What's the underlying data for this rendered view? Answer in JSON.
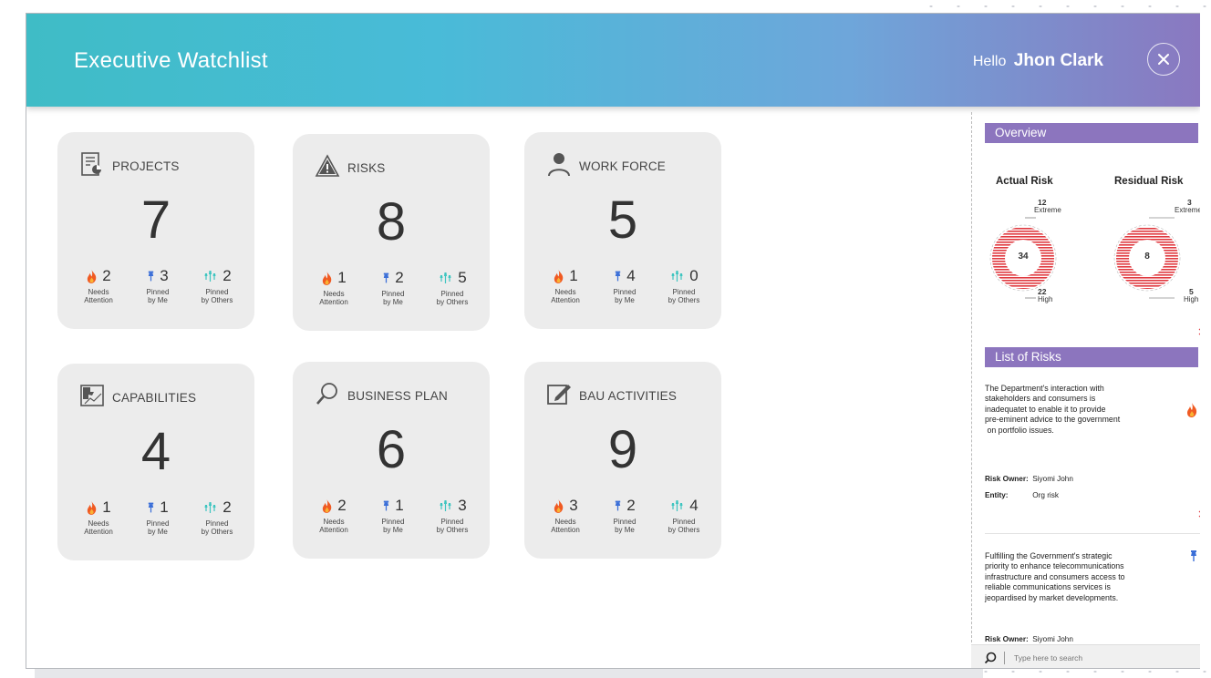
{
  "header": {
    "title": "Executive Watchlist",
    "greeting": "Hello",
    "user_name": "Jhon Clark"
  },
  "cards": [
    {
      "title": "PROJECTS",
      "icon": "document-chart-icon",
      "count": "7",
      "needs_attention": "2",
      "pinned_by_me": "3",
      "pinned_by_others": "2"
    },
    {
      "title": "RISKS",
      "icon": "warning-triangle-icon",
      "count": "8",
      "needs_attention": "1",
      "pinned_by_me": "2",
      "pinned_by_others": "5"
    },
    {
      "title": "WORK FORCE",
      "icon": "person-icon",
      "count": "5",
      "needs_attention": "1",
      "pinned_by_me": "4",
      "pinned_by_others": "0"
    },
    {
      "title": "CAPABILITIES",
      "icon": "puzzle-image-icon",
      "count": "4",
      "needs_attention": "1",
      "pinned_by_me": "1",
      "pinned_by_others": "2"
    },
    {
      "title": "BUSINESS PLAN",
      "icon": "magnifier-icon",
      "count": "6",
      "needs_attention": "2",
      "pinned_by_me": "1",
      "pinned_by_others": "3"
    },
    {
      "title": "BAU ACTIVITIES",
      "icon": "edit-pencil-icon",
      "count": "9",
      "needs_attention": "3",
      "pinned_by_me": "2",
      "pinned_by_others": "4"
    }
  ],
  "stat_labels": {
    "needs_attention": [
      "Needs",
      "Attention"
    ],
    "pinned_by_me": [
      "Pinned",
      "by Me"
    ],
    "pinned_by_others": [
      "Pinned",
      "by Others"
    ]
  },
  "overview": {
    "title": "Overview",
    "actual": {
      "label": "Actual Risk",
      "total": "34",
      "extreme_count": "12",
      "extreme_label": "Extreme",
      "high_count": "22",
      "high_label": "High"
    },
    "residual": {
      "label": "Residual Risk",
      "total": "8",
      "extreme_count": "3",
      "extreme_label": "Extreme",
      "high_count": "5",
      "high_label": "High"
    }
  },
  "risk_list": {
    "title": "List of Risks",
    "owner_label": "Risk Owner:",
    "entity_label": "Entity:",
    "items": [
      {
        "lines": [
          "The Department's interaction with",
          "stakeholders and consumers is",
          "inadequatet to enable it to provide",
          "pre-eminent advice to the government",
          " on portfolio issues."
        ],
        "owner": "Siyomi John",
        "entity": "Org risk",
        "icon": "flame-icon"
      },
      {
        "lines": [
          "Fulfilling the Government's strategic",
          "priority to enhance telecommunications",
          "infrastructure and consumers access to",
          "reliable communications services is",
          "jeopardised by market developments."
        ],
        "owner": "Siyomi John",
        "icon": "pin-icon"
      }
    ]
  },
  "search": {
    "placeholder": "Type here to search"
  },
  "colors": {
    "accent": "#8c75be",
    "flame": "#f05a22",
    "pin": "#3b6fd8",
    "shared": "#3ec5c0",
    "gauge": "#e0393f"
  }
}
